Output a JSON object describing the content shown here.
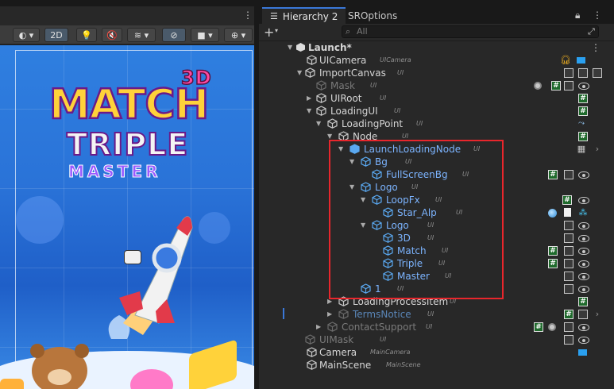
{
  "scene": {
    "toolbar": {
      "mode_2d": "2D"
    },
    "logo": {
      "word_3d": "3D",
      "word_match": "MATCH",
      "word_triple": "TRIPLE",
      "word_master": "MASTER"
    }
  },
  "hierarchy": {
    "tabs": [
      {
        "label": "Hierarchy 2",
        "icon": "list-icon"
      },
      {
        "label": "SROptions"
      }
    ],
    "search": {
      "placeholder": "All"
    },
    "add_label": "+",
    "rows": [
      {
        "name": "Launch*",
        "tag": "",
        "style": "white"
      },
      {
        "name": "UICamera",
        "tag": "UICamera",
        "style": "white"
      },
      {
        "name": "ImportCanvas",
        "tag": "UI",
        "style": "white"
      },
      {
        "name": "Mask",
        "tag": "UI",
        "style": "gray"
      },
      {
        "name": "UIRoot",
        "tag": "UI",
        "style": "white"
      },
      {
        "name": "LoadingUI",
        "tag": "UI",
        "style": "white"
      },
      {
        "name": "LoadingPoint",
        "tag": "UI",
        "style": "white"
      },
      {
        "name": "Node",
        "tag": "UI",
        "style": "white"
      },
      {
        "name": "LaunchLoadingNode",
        "tag": "UI",
        "style": "blue"
      },
      {
        "name": "Bg",
        "tag": "UI",
        "style": "blue"
      },
      {
        "name": "FullScreenBg",
        "tag": "UI",
        "style": "blue"
      },
      {
        "name": "Logo",
        "tag": "UI",
        "style": "blue"
      },
      {
        "name": "LoopFx",
        "tag": "UI",
        "style": "blue"
      },
      {
        "name": "Star_Alp",
        "tag": "UI",
        "style": "blue"
      },
      {
        "name": "Logo",
        "tag": "UI",
        "style": "blue"
      },
      {
        "name": "3D",
        "tag": "UI",
        "style": "blue"
      },
      {
        "name": "Match",
        "tag": "UI",
        "style": "blue"
      },
      {
        "name": "Triple",
        "tag": "UI",
        "style": "blue"
      },
      {
        "name": "Master",
        "tag": "UI",
        "style": "blue"
      },
      {
        "name": "1",
        "tag": "UI",
        "style": "blue"
      },
      {
        "name": "LoadingProcessItem",
        "tag": "UI",
        "style": "white"
      },
      {
        "name": "TermsNotice",
        "tag": "UI",
        "style": "gray-blue"
      },
      {
        "name": "ContactSupport",
        "tag": "UI",
        "style": "gray"
      },
      {
        "name": "UIMask",
        "tag": "UI",
        "style": "gray"
      },
      {
        "name": "Camera",
        "tag": "MainCamera",
        "style": "white"
      },
      {
        "name": "MainScene",
        "tag": "MainScene",
        "style": "white"
      }
    ]
  },
  "colors": {
    "selection_outline": "#e8262c",
    "prefab_blue": "#7cb4ff",
    "accent": "#3a78d8"
  }
}
